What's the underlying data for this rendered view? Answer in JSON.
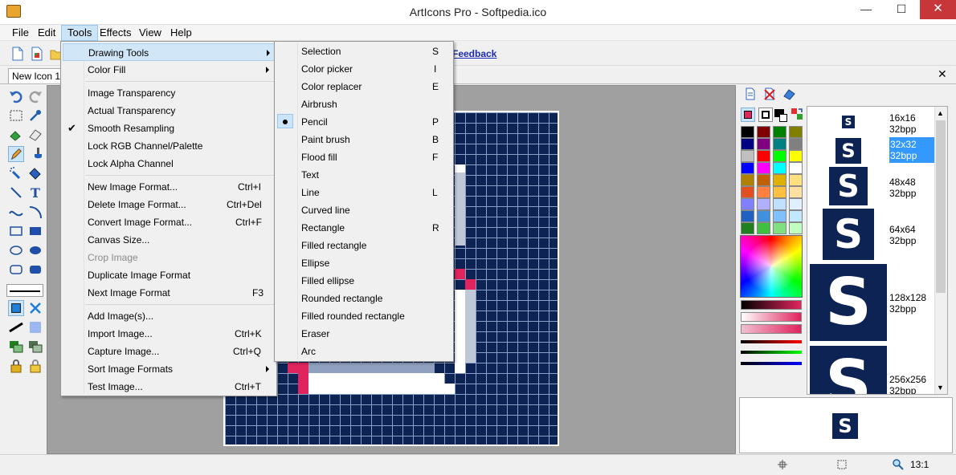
{
  "window": {
    "title": "ArtIcons Pro - Softpedia.ico"
  },
  "menubar": [
    {
      "label": "File"
    },
    {
      "label": "Edit"
    },
    {
      "label": "Tools"
    },
    {
      "label": "Effects"
    },
    {
      "label": "View"
    },
    {
      "label": "Help"
    }
  ],
  "toolbar": {
    "feedback_label": "Feedback"
  },
  "document": {
    "tab_label": "New Icon 1"
  },
  "tools_menu": [
    {
      "label": "Drawing Tools",
      "shortcut": ""
    },
    {
      "label": "Color Fill",
      "shortcut": ""
    },
    {
      "label": "Image Transparency",
      "shortcut": ""
    },
    {
      "label": "Actual Transparency",
      "shortcut": ""
    },
    {
      "label": "Smooth Resampling",
      "shortcut": ""
    },
    {
      "label": "Lock RGB Channel/Palette",
      "shortcut": ""
    },
    {
      "label": "Lock Alpha Channel",
      "shortcut": ""
    },
    {
      "label": "New Image Format...",
      "shortcut": "Ctrl+I"
    },
    {
      "label": "Delete Image Format...",
      "shortcut": "Ctrl+Del"
    },
    {
      "label": "Convert Image Format...",
      "shortcut": "Ctrl+F"
    },
    {
      "label": "Canvas Size...",
      "shortcut": ""
    },
    {
      "label": "Crop Image",
      "shortcut": ""
    },
    {
      "label": "Duplicate Image Format",
      "shortcut": ""
    },
    {
      "label": "Next Image Format",
      "shortcut": "F3"
    },
    {
      "label": "Add  Image(s)...",
      "shortcut": ""
    },
    {
      "label": "Import Image...",
      "shortcut": "Ctrl+K"
    },
    {
      "label": "Capture Image...",
      "shortcut": "Ctrl+Q"
    },
    {
      "label": "Sort Image Formats",
      "shortcut": ""
    },
    {
      "label": "Test Image...",
      "shortcut": "Ctrl+T"
    }
  ],
  "drawing_menu": [
    {
      "label": "Selection",
      "shortcut": "S"
    },
    {
      "label": "Color picker",
      "shortcut": "I"
    },
    {
      "label": "Color replacer",
      "shortcut": "E"
    },
    {
      "label": "Airbrush",
      "shortcut": ""
    },
    {
      "label": "Pencil",
      "shortcut": "P"
    },
    {
      "label": "Paint brush",
      "shortcut": "B"
    },
    {
      "label": "Flood fill",
      "shortcut": "F"
    },
    {
      "label": "Text",
      "shortcut": ""
    },
    {
      "label": "Line",
      "shortcut": "L"
    },
    {
      "label": "Curved line",
      "shortcut": ""
    },
    {
      "label": "Rectangle",
      "shortcut": "R"
    },
    {
      "label": "Filled rectangle",
      "shortcut": ""
    },
    {
      "label": "Ellipse",
      "shortcut": ""
    },
    {
      "label": "Filled ellipse",
      "shortcut": ""
    },
    {
      "label": "Rounded rectangle",
      "shortcut": ""
    },
    {
      "label": "Filled rounded rectangle",
      "shortcut": ""
    },
    {
      "label": "Eraser",
      "shortcut": ""
    },
    {
      "label": "Arc",
      "shortcut": ""
    }
  ],
  "formats": [
    {
      "size": "16x16",
      "depth": "32bpp"
    },
    {
      "size": "32x32",
      "depth": "32bpp"
    },
    {
      "size": "48x48",
      "depth": "32bpp"
    },
    {
      "size": "64x64",
      "depth": "32bpp"
    },
    {
      "size": "128x128",
      "depth": "32bpp"
    },
    {
      "size": "256x256",
      "depth": "32bpp"
    }
  ],
  "thumb_glyph": "S",
  "status": {
    "zoom": "13:1"
  },
  "palette": [
    "#000000",
    "#800000",
    "#008000",
    "#808000",
    "#000080",
    "#800080",
    "#008080",
    "#808080",
    "#c0c0c0",
    "#ff0000",
    "#00ff00",
    "#ffff00",
    "#0000ff",
    "#ff00ff",
    "#00ffff",
    "#ffffff",
    "#b08000",
    "#c06000",
    "#e0b000",
    "#ffe080",
    "#e05020",
    "#ff8040",
    "#ffc040",
    "#ffe0a0",
    "#8080ff",
    "#b0b0ff",
    "#c0e0ff",
    "#e0f0ff",
    "#2060c0",
    "#4090e0",
    "#80c0ff",
    "#c0e8ff",
    "#208020",
    "#40c040",
    "#80e080",
    "#c0ffc0"
  ],
  "colors": {
    "primary": "#e0245e",
    "secondary": "#ffffff",
    "icon_bg": "#0c2354"
  }
}
